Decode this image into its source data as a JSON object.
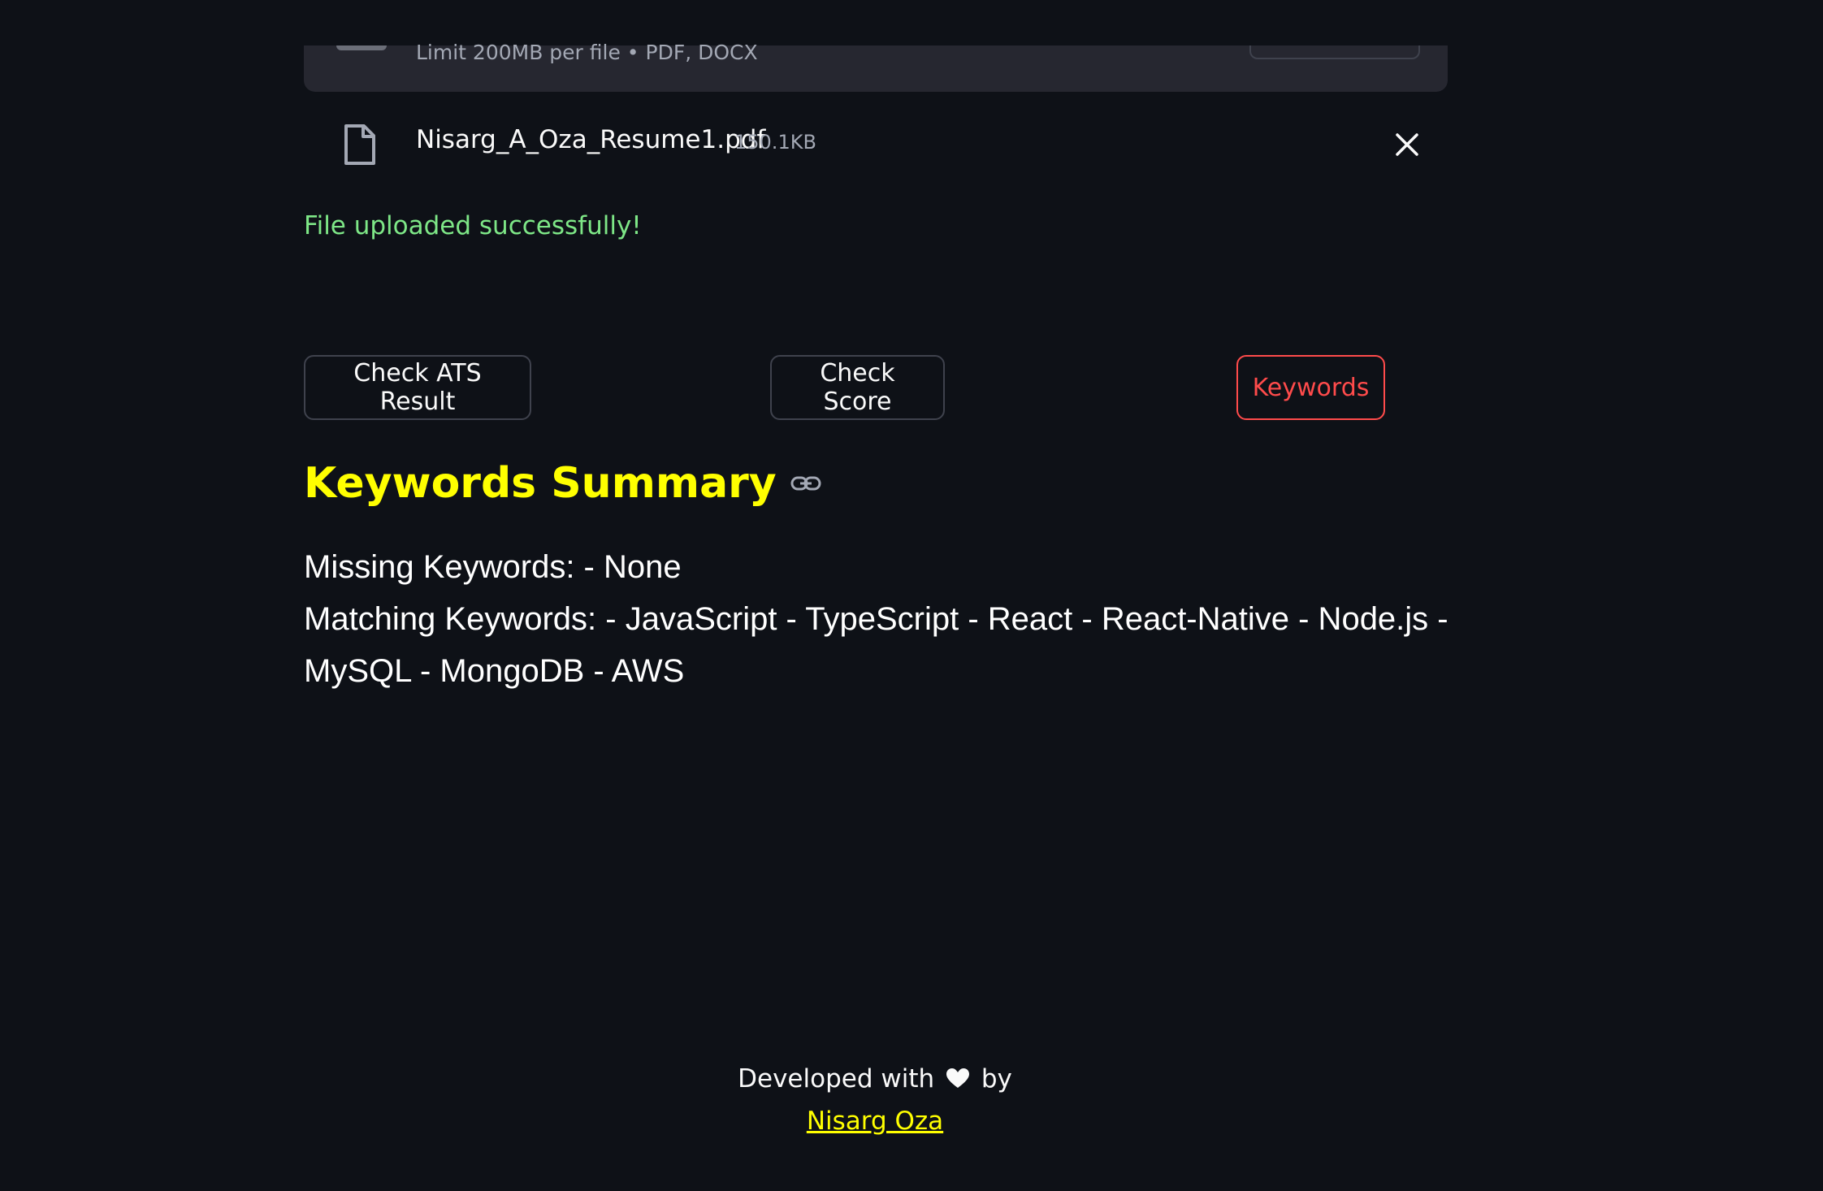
{
  "uploader": {
    "limit_text": "Limit 200MB per file • PDF, DOCX",
    "file_name": "Nisarg_A_Oza_Resume1.pdf",
    "file_size": "150.1KB",
    "status_message": "File uploaded successfully!"
  },
  "buttons": {
    "check_ats": "Check ATS Result",
    "check_score": "Check Score",
    "keywords": "Keywords"
  },
  "summary": {
    "heading": "Keywords Summary",
    "missing": "Missing Keywords: - None",
    "matching": "Matching Keywords: - JavaScript - TypeScript - React - React-Native - Node.js - MySQL - MongoDB - AWS"
  },
  "footer": {
    "prefix": "Developed with",
    "suffix": "by",
    "author": "Nisarg Oza"
  },
  "colors": {
    "background": "#0e1117",
    "heading": "#ffff00",
    "success": "#7ee787",
    "active_button": "#ff4b4b"
  },
  "icons": [
    "file-icon",
    "close-icon",
    "link-icon",
    "heart-icon"
  ]
}
